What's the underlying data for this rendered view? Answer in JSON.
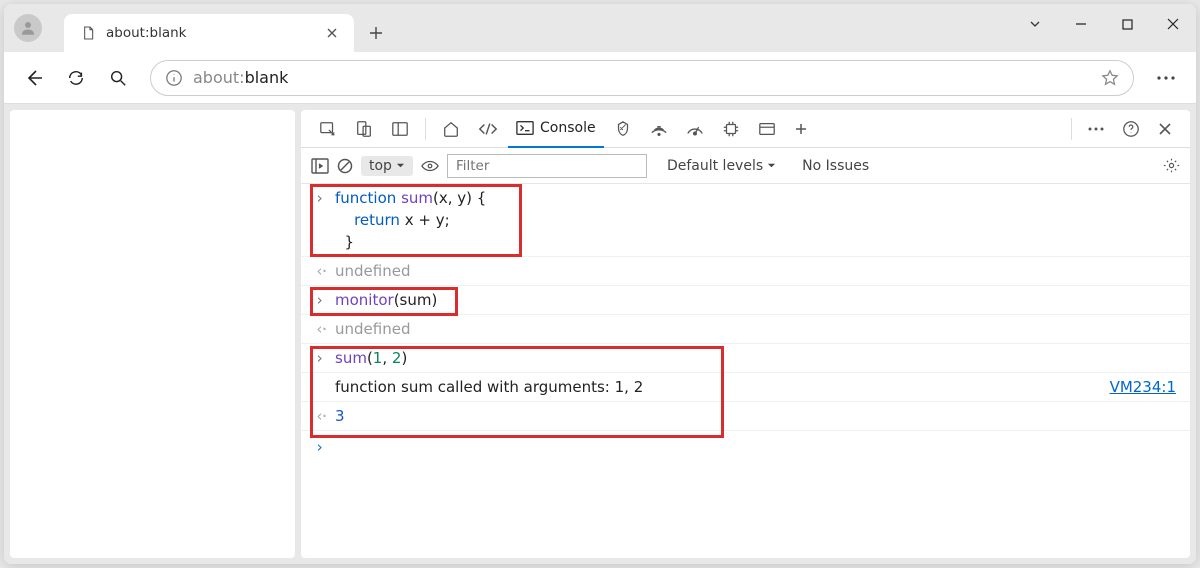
{
  "tab": {
    "title": "about:blank"
  },
  "url": {
    "prefix": "about:",
    "rest": "blank"
  },
  "devtools": {
    "active_tab": "Console",
    "filter_placeholder": "Filter",
    "levels": "Default levels",
    "issues": "No Issues",
    "context": "top"
  },
  "console": {
    "entries": [
      {
        "type": "in",
        "code_html": "<span class='kw'>function</span> <span class='fn'>sum</span>(x, y) {\n    <span class='kw'>return</span> x + y;\n  }"
      },
      {
        "type": "out",
        "text": "undefined",
        "cls": "undef"
      },
      {
        "type": "in",
        "code_html": "<span class='fn'>monitor</span>(sum)"
      },
      {
        "type": "out",
        "text": "undefined",
        "cls": "undef"
      },
      {
        "type": "in",
        "code_html": "<span class='fn'>sum</span>(<span class='num'>1</span>, <span class='num'>2</span>)"
      },
      {
        "type": "log",
        "text": "function sum called with arguments: 1, 2",
        "link": "VM234:1"
      },
      {
        "type": "out",
        "text": "3",
        "cls": "retnum"
      }
    ]
  }
}
